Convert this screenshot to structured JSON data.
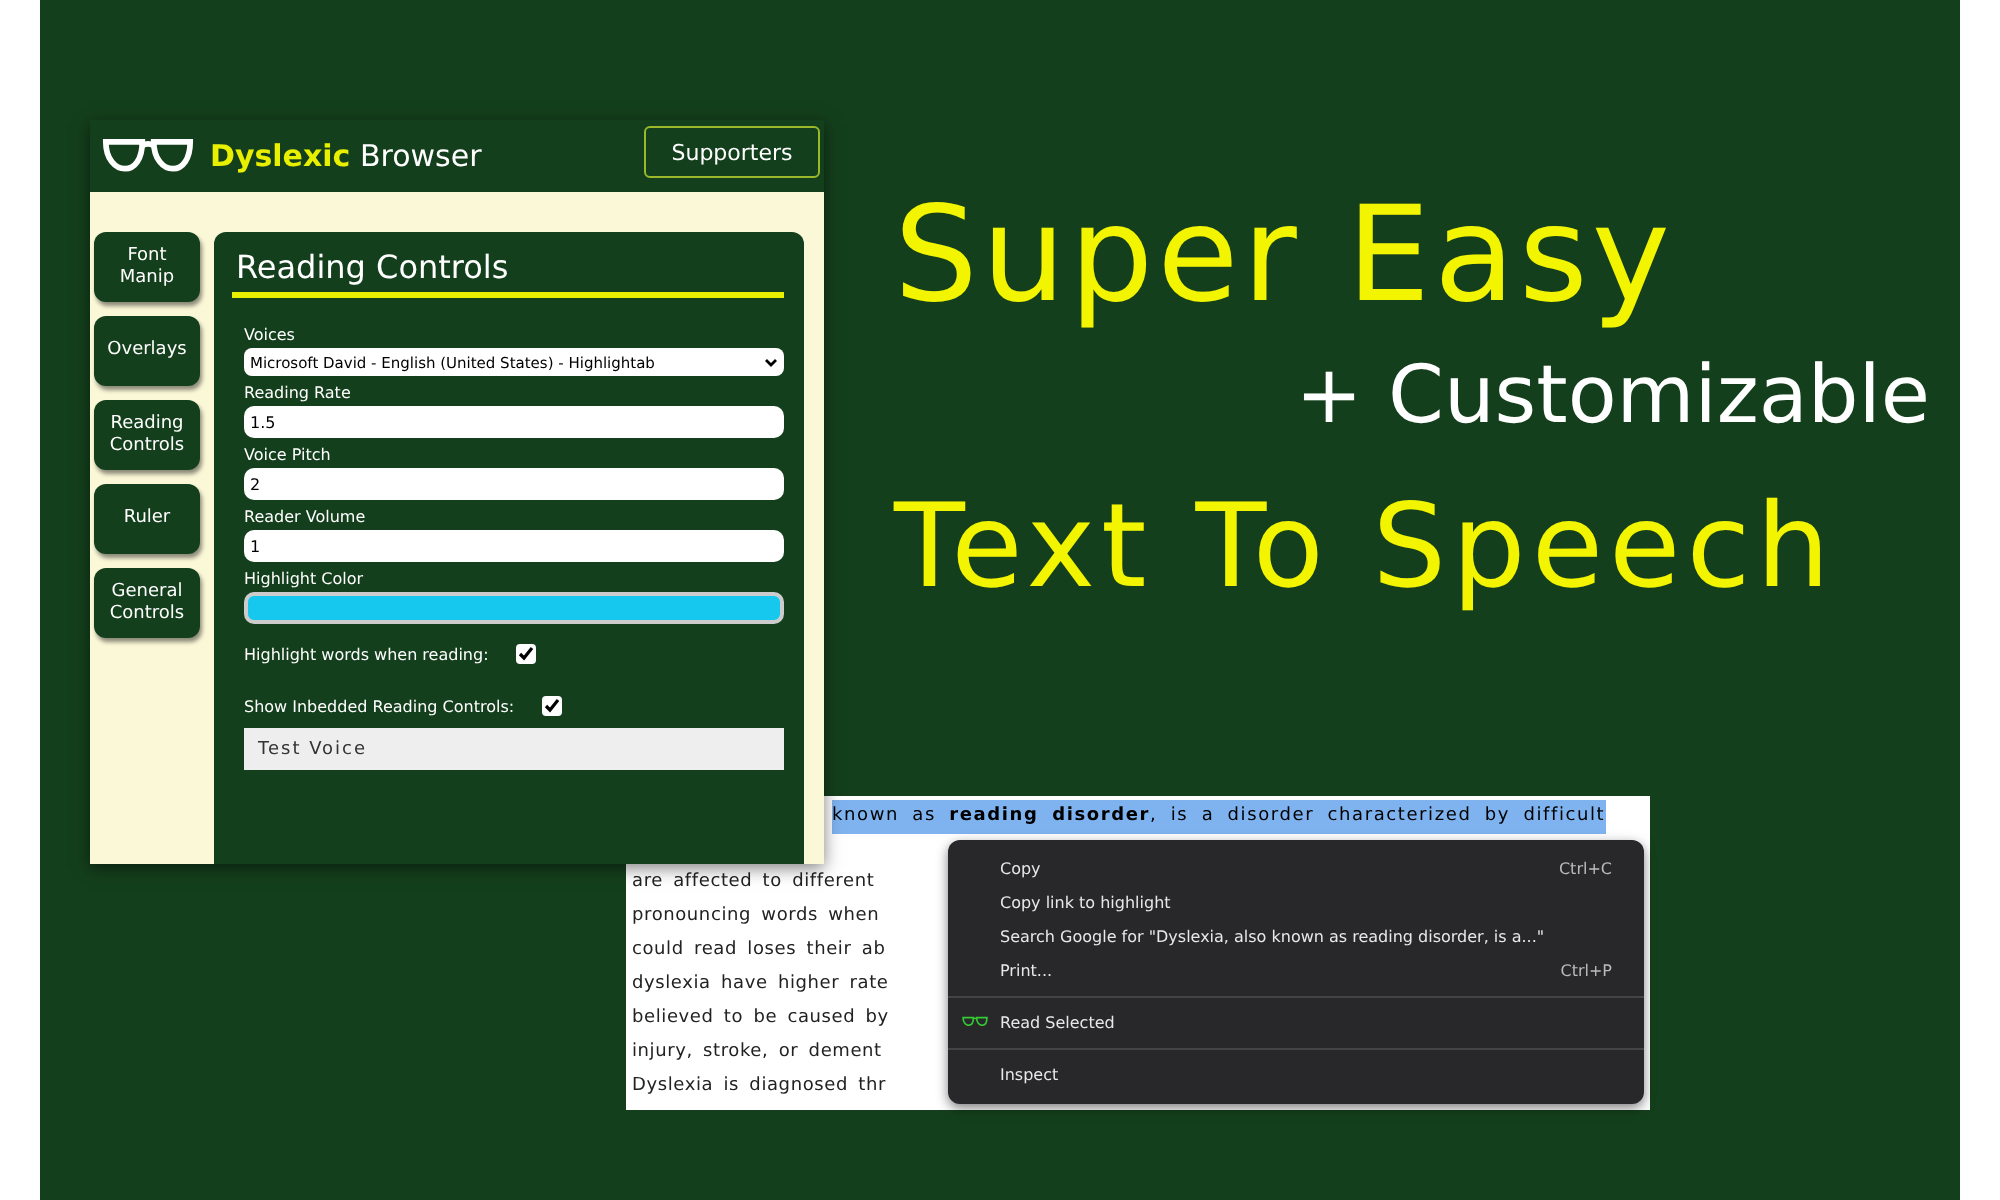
{
  "extension": {
    "brand_first": "Dyslexic",
    "brand_second": "Browser",
    "supporters_button": "Supporters",
    "tabs": [
      {
        "label": "Font Manip"
      },
      {
        "label": "Overlays"
      },
      {
        "label": "Reading Controls"
      },
      {
        "label": "Ruler"
      },
      {
        "label": "General Controls"
      }
    ],
    "panel": {
      "title": "Reading Controls",
      "fields": [
        {
          "kind": "select",
          "label": "Voices",
          "value": "Microsoft David - English (United States) - Highlightab"
        },
        {
          "kind": "text",
          "label": "Reading Rate",
          "value": "1.5"
        },
        {
          "kind": "text",
          "label": "Voice Pitch",
          "value": "2"
        },
        {
          "kind": "text",
          "label": "Reader Volume",
          "value": "1"
        },
        {
          "kind": "color",
          "label": "Highlight Color",
          "color": "#16c8ee"
        },
        {
          "kind": "checkbox",
          "label": "Highlight words when reading:",
          "checked": true
        },
        {
          "kind": "checkbox",
          "label": "Show Inbedded Reading Controls:",
          "checked": true
        },
        {
          "kind": "button",
          "label": "Test Voice"
        }
      ]
    }
  },
  "headline": {
    "line_1": "Super Easy",
    "line_2": "+ Customizable",
    "line_3": "Text To Speech"
  },
  "web_page": {
    "lines": [
      {
        "text": "known as **reading disorder**, is a disorder characterized by difficult",
        "selected": true
      },
      {
        "text": "are affected to different",
        "selected": false
      },
      {
        "text": "pronouncing words when",
        "selected": false
      },
      {
        "text": "could read loses their ab",
        "selected": false
      },
      {
        "text": "dyslexia have higher rate",
        "selected": false
      },
      {
        "text": "believed to be caused by",
        "selected": false
      },
      {
        "text": "injury, stroke, or dement",
        "selected": false
      },
      {
        "text": "Dyslexia is diagnosed thr",
        "selected": false
      }
    ]
  },
  "context_menu": {
    "items": [
      {
        "kind": "item",
        "label": "Copy",
        "shortcut": "Ctrl+C"
      },
      {
        "kind": "item",
        "label": "Copy link to highlight"
      },
      {
        "kind": "item",
        "label": "Search Google for \"Dyslexia, also known as reading disorder, is a...\""
      },
      {
        "kind": "item",
        "label": "Print...",
        "shortcut": "Ctrl+P"
      },
      {
        "kind": "divider"
      },
      {
        "kind": "extension",
        "label": "Read Selected"
      },
      {
        "kind": "divider"
      },
      {
        "kind": "item",
        "label": "Inspect"
      }
    ]
  }
}
